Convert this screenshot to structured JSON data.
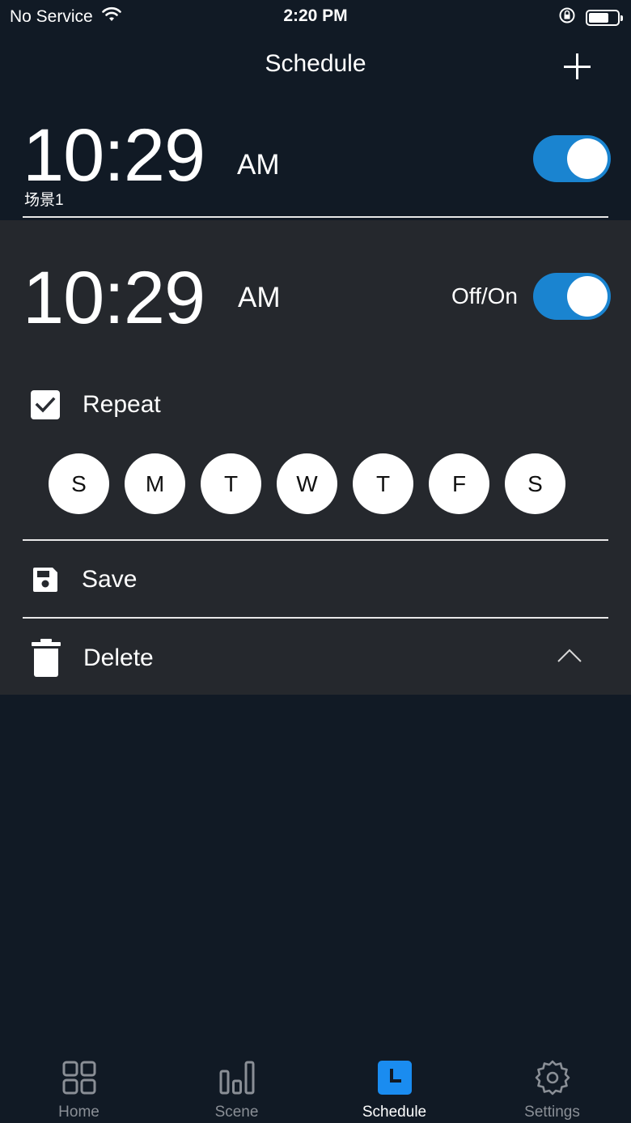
{
  "status_bar": {
    "carrier": "No Service",
    "time": "2:20 PM"
  },
  "nav": {
    "title": "Schedule"
  },
  "schedules": [
    {
      "time": "10:29",
      "ampm": "AM",
      "name": "场景1",
      "enabled": true
    }
  ],
  "editor": {
    "time": "10:29",
    "ampm": "AM",
    "toggle_label": "Off/On",
    "enabled": true,
    "repeat_label": "Repeat",
    "repeat_checked": true,
    "days": [
      "S",
      "M",
      "T",
      "W",
      "T",
      "F",
      "S"
    ],
    "save_label": "Save",
    "delete_label": "Delete"
  },
  "tabs": [
    {
      "label": "Home",
      "icon": "grid-icon",
      "active": false
    },
    {
      "label": "Scene",
      "icon": "bar-chart-icon",
      "active": false
    },
    {
      "label": "Schedule",
      "icon": "clock-icon",
      "active": true
    },
    {
      "label": "Settings",
      "icon": "gear-icon",
      "active": false
    }
  ],
  "colors": {
    "background": "#111a25",
    "panel": "#25282d",
    "accent": "#1a84d0",
    "tab_active_icon": "#1a8cf0",
    "tab_inactive": "#8a8f96"
  }
}
